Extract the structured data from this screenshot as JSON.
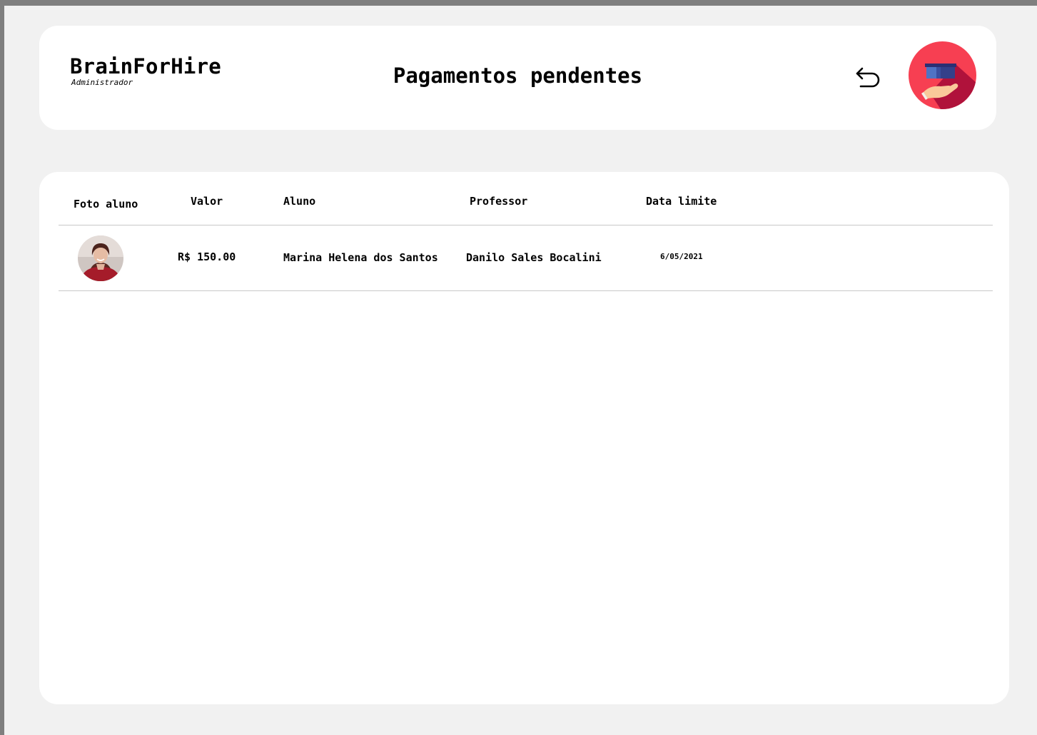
{
  "header": {
    "brand": "BrainForHire",
    "role": "Administrador",
    "title": "Pagamentos pendentes",
    "back_icon": "back-arrow-icon",
    "logo_icon": "graduation-cap-hand-logo",
    "logo_color": "#f73f52"
  },
  "table": {
    "columns": [
      "Foto aluno",
      "Valor",
      "Aluno",
      "Professor",
      "Data limite"
    ],
    "rows": [
      {
        "photo": "student-avatar",
        "valor": "R$ 150.00",
        "aluno": "Marina Helena dos Santos",
        "professor": "Danilo Sales Bocalini",
        "data_limite": "6/05/2021"
      }
    ]
  }
}
